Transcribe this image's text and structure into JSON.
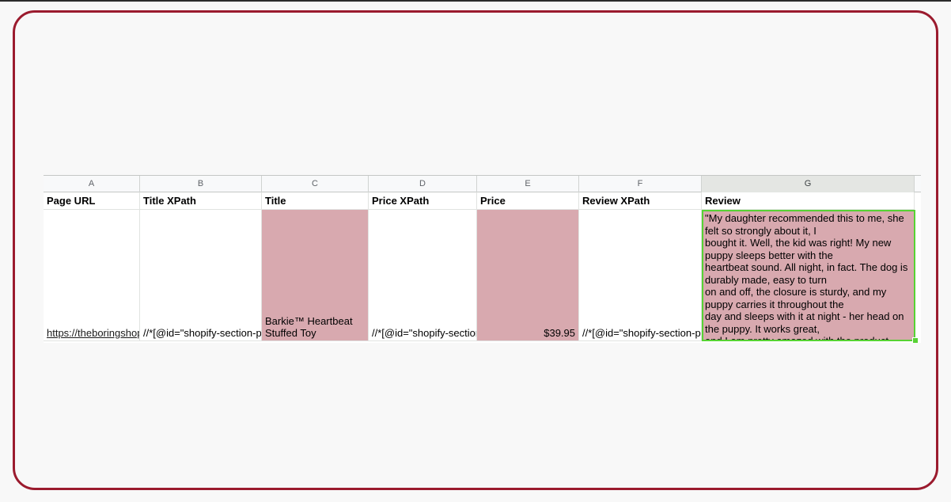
{
  "sheet": {
    "columns": [
      "A",
      "B",
      "C",
      "D",
      "E",
      "F",
      "G"
    ],
    "headers": [
      "Page URL",
      "Title XPath",
      "Title",
      "Price XPath",
      "Price",
      "Review XPath",
      "Review"
    ],
    "row": {
      "page_url": "https://theboringshop",
      "title_xpath": "//*[@id=\"shopify-section-p",
      "title": "Barkie™ Heartbeat Stuffed Toy",
      "price_xpath": "//*[@id=\"shopify-section",
      "price": "$39.95",
      "review_xpath": "//*[@id=\"shopify-section-p",
      "review_lines": [
        "\"My daughter recommended this to me, she",
        "felt so strongly about it, I",
        "bought it. Well, the kid was right! My new",
        "puppy sleeps better with the",
        "heartbeat sound. All night, in fact. The dog is",
        "durably made, easy to turn",
        "on and off, the closure is sturdy, and my",
        "puppy carries it throughout the",
        "day and sleeps with it at night - her head on",
        "the puppy. It works great,",
        "and I am pretty amazed with the product"
      ]
    }
  },
  "colors": {
    "frame_border": "#9b1b2e",
    "highlight_fill": "#d8a9af",
    "selection_border": "#57d234"
  }
}
